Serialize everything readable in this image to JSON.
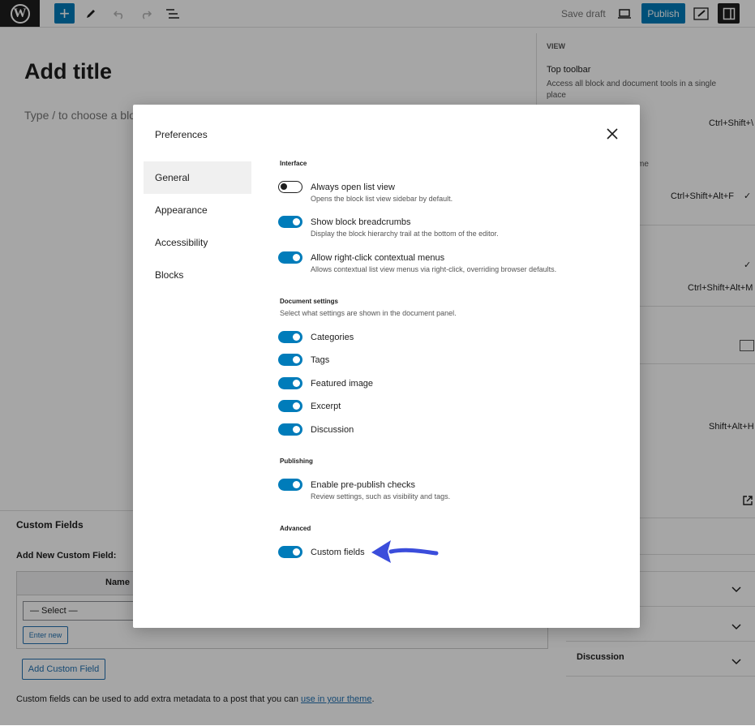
{
  "toolbar": {
    "save_draft": "Save draft",
    "publish": "Publish",
    "logo": "W",
    "add": "+"
  },
  "editor": {
    "title_placeholder": "Add title",
    "block_placeholder": "Type / to choose a block"
  },
  "right_panel": {
    "view_heading": "VIEW",
    "top_toolbar_label": "Top toolbar",
    "top_toolbar_desc": "Access all block and document tools in a single place",
    "shortcut_1": "Ctrl+Shift+Alt+F",
    "shortcut_2": "Ctrl+Shift+Alt+M",
    "shortcut_3": "Shift+Alt+H",
    "shortcut_top": "Ctrl+Shift+\\",
    "partial_text": "me",
    "check": "✓"
  },
  "custom_fields_panel": {
    "title": "Custom Fields",
    "add_new": "Add New Custom Field:",
    "name_header": "Name",
    "select_value": "— Select —",
    "enter_new": "Enter new",
    "add_button": "Add Custom Field",
    "note": "Custom fields can be used to add extra metadata to a post that you can ",
    "note_link": "use in your theme",
    "note_end": "."
  },
  "accordions": {
    "discussion": "Discussion"
  },
  "modal": {
    "title": "Preferences",
    "nav": [
      "General",
      "Appearance",
      "Accessibility",
      "Blocks"
    ],
    "interface": {
      "heading": "Interface",
      "options": [
        {
          "label": "Always open list view",
          "desc": "Opens the block list view sidebar by default.",
          "on": false
        },
        {
          "label": "Show block breadcrumbs",
          "desc": "Display the block hierarchy trail at the bottom of the editor.",
          "on": true
        },
        {
          "label": "Allow right-click contextual menus",
          "desc": "Allows contextual list view menus via right-click, overriding browser defaults.",
          "on": true
        }
      ]
    },
    "document": {
      "heading": "Document settings",
      "desc": "Select what settings are shown in the document panel.",
      "options": [
        "Categories",
        "Tags",
        "Featured image",
        "Excerpt",
        "Discussion"
      ]
    },
    "publishing": {
      "heading": "Publishing",
      "label": "Enable pre-publish checks",
      "desc": "Review settings, such as visibility and tags."
    },
    "advanced": {
      "heading": "Advanced",
      "label": "Custom fields"
    }
  },
  "colors": {
    "accent": "#007cba",
    "arrow": "#3b4ddb"
  }
}
